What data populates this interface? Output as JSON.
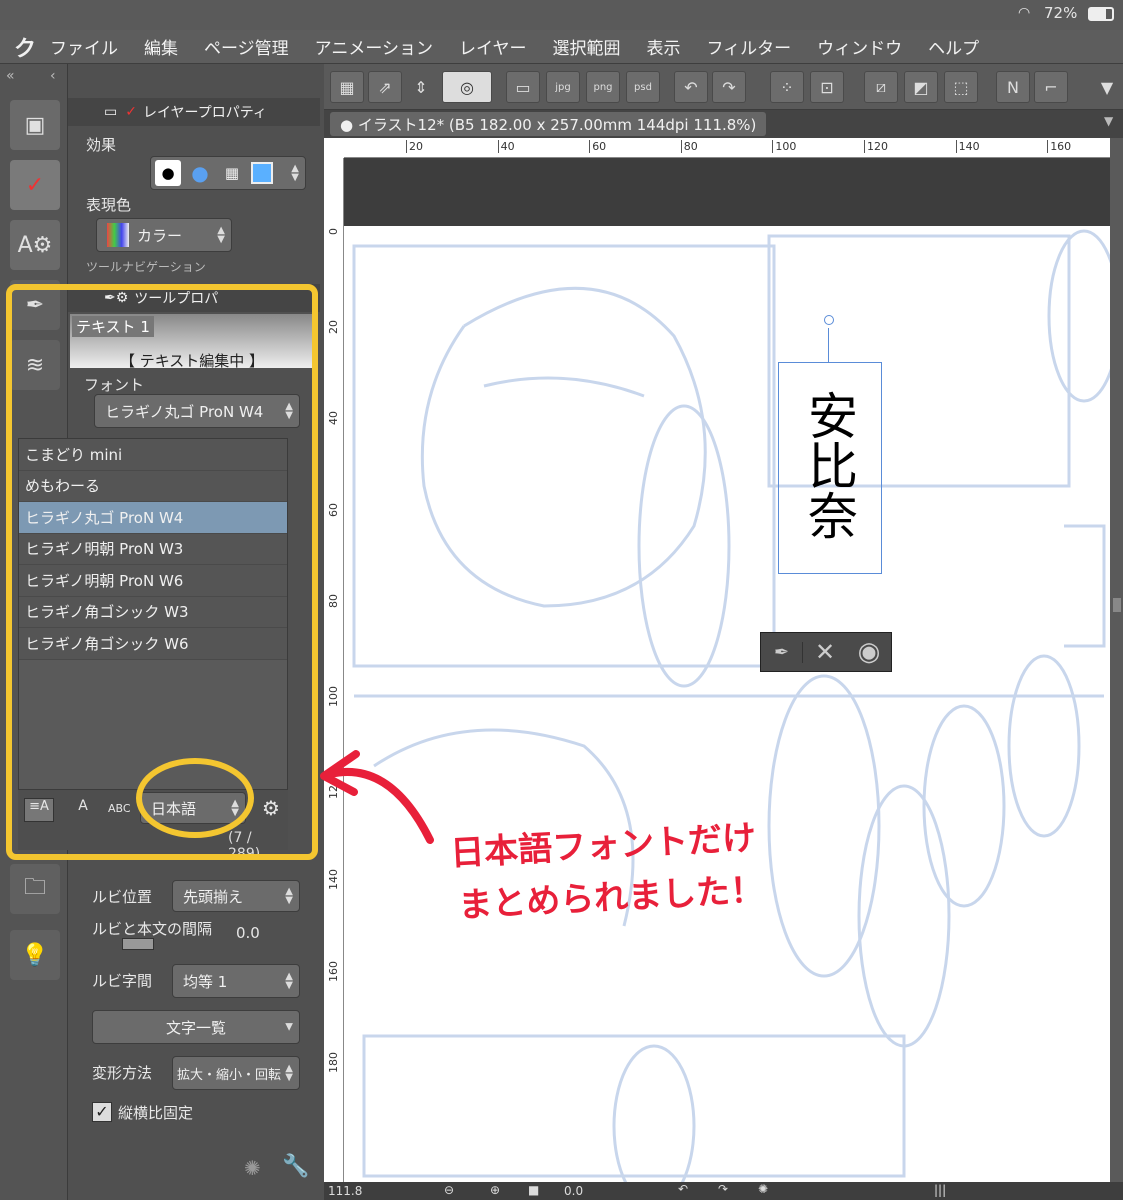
{
  "status": {
    "wifi": "wifi-icon",
    "battery_percent": "72%"
  },
  "menu": {
    "logo": "ク",
    "items": [
      "ファイル",
      "編集",
      "ページ管理",
      "アニメーション",
      "レイヤー",
      "選択範囲",
      "表示",
      "フィルター",
      "ウィンドウ",
      "ヘルプ"
    ]
  },
  "layer_panel": {
    "tab_label": "レイヤープロパティ",
    "effect_label": "効果",
    "color_label": "表現色",
    "color_value": "カラー",
    "next_label": "ツールナビゲーション"
  },
  "tool_panel": {
    "tab_label": "ツールプロパ",
    "subtool_name": "テキスト 1",
    "editing_label": "【 テキスト編集中 】",
    "font_label": "フォント",
    "font_value": "ヒラギノ丸ゴ ProN W4"
  },
  "font_list": {
    "items": [
      {
        "name": "こまどり mini",
        "selected": false
      },
      {
        "name": "めもわーる",
        "selected": false
      },
      {
        "name": "ヒラギノ丸ゴ ProN W4",
        "selected": true
      },
      {
        "name": "ヒラギノ明朝 ProN W3",
        "selected": false
      },
      {
        "name": "ヒラギノ明朝 ProN W6",
        "selected": false
      },
      {
        "name": "ヒラギノ角ゴシック W3",
        "selected": false
      },
      {
        "name": "ヒラギノ角ゴシック W6",
        "selected": false
      }
    ],
    "filter_value": "日本語",
    "abc_label": "ABC",
    "count": "(7 / 289)"
  },
  "ruby": {
    "position_label": "ルビ位置",
    "position_value": "先頭揃え",
    "gap_label": "ルビと本文の間隔",
    "gap_value": "0.0",
    "spacing_label": "ルビ字間",
    "spacing_value": "均等 1",
    "char_list": "文字一覧",
    "transform_label": "変形方法",
    "transform_value": "拡大・縮小・回転",
    "aspect_label": "縦横比固定"
  },
  "document": {
    "tab_title": "イラスト12* (B5 182.00 x 257.00mm 144dpi 111.8%)",
    "ruler_h": [
      "20",
      "40",
      "60",
      "80",
      "100",
      "120",
      "140",
      "160"
    ],
    "ruler_v": [
      "0",
      "20",
      "40",
      "60",
      "80",
      "100",
      "120",
      "140",
      "160",
      "180"
    ],
    "canvas_text": "安比奈"
  },
  "bottom": {
    "zoom": "111.8",
    "angle": "0.0"
  },
  "annotation": {
    "line1": "日本語フォントだけ",
    "line2": "まとめられました！"
  },
  "colors": {
    "highlight": "#f4c630",
    "annotation": "#e8203a",
    "selection": "#7d99b3"
  }
}
